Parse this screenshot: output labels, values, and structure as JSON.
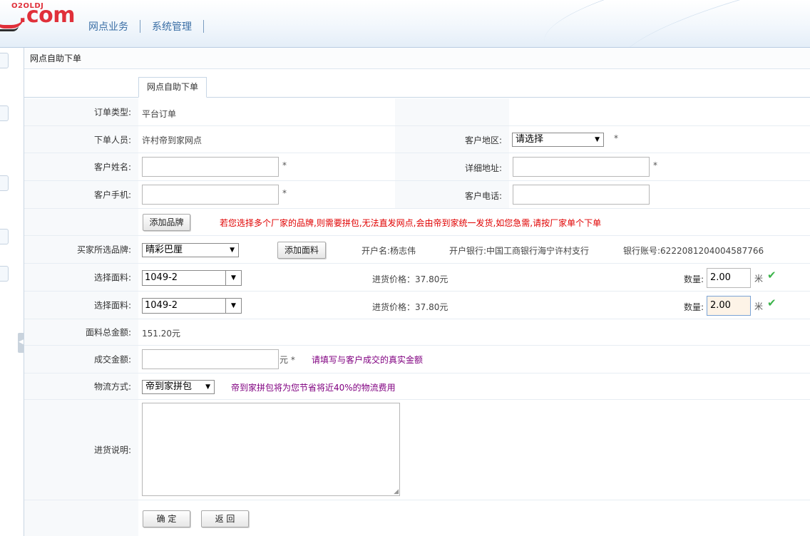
{
  "header": {
    "logo_small": "O2OLDJ",
    "logo_big": ".com",
    "nav": [
      "网点业务",
      "系统管理"
    ]
  },
  "panel": {
    "title": "网点自助下单",
    "tab": "网点自助下单"
  },
  "form": {
    "order_type_label": "订单类型:",
    "order_type_value": "平台订单",
    "orderer_label": "下单人员:",
    "orderer_value": "许村帝到家网点",
    "region_label": "客户地区:",
    "region_value": "请选择",
    "customer_name_label": "客户姓名:",
    "address_label": "详细地址:",
    "mobile_label": "客户手机:",
    "phone_label": "客户电话:",
    "required_mark": "*",
    "add_brand_button": "添加品牌",
    "brand_notice": "若您选择多个厂家的品牌,则需要拼包,无法直发网点,会由帝到家统一发货,如您急需,请按厂家单个下单",
    "brand_label": "买家所选品牌:",
    "brand_value": "晴彩巴厘",
    "add_fabric_button": "添加面料",
    "account_name": "开户名:杨志伟",
    "bank_name": "开户银行:中国工商银行海宁许村支行",
    "bank_account": "银行账号:6222081204004587766",
    "fabric_rows": [
      {
        "label": "选择面料:",
        "value": "1049-2",
        "price": "进货价格：37.80元",
        "qty_label": "数量:",
        "qty": "2.00",
        "unit": "米"
      },
      {
        "label": "选择面料:",
        "value": "1049-2",
        "price": "进货价格：37.80元",
        "qty_label": "数量:",
        "qty": "2.00",
        "unit": "米"
      }
    ],
    "fabric_total_label": "面料总金额:",
    "fabric_total_value": "151.20元",
    "deal_amount_label": "成交金额:",
    "deal_amount_unit": "元 *",
    "deal_amount_hint": "请填写与客户成交的真实金额",
    "shipping_label": "物流方式:",
    "shipping_value": "帝到家拼包",
    "shipping_hint": "帝到家拼包将为您节省将近40%的物流费用",
    "note_label": "进货说明:",
    "confirm_button": "确 定",
    "back_button": "返 回"
  }
}
